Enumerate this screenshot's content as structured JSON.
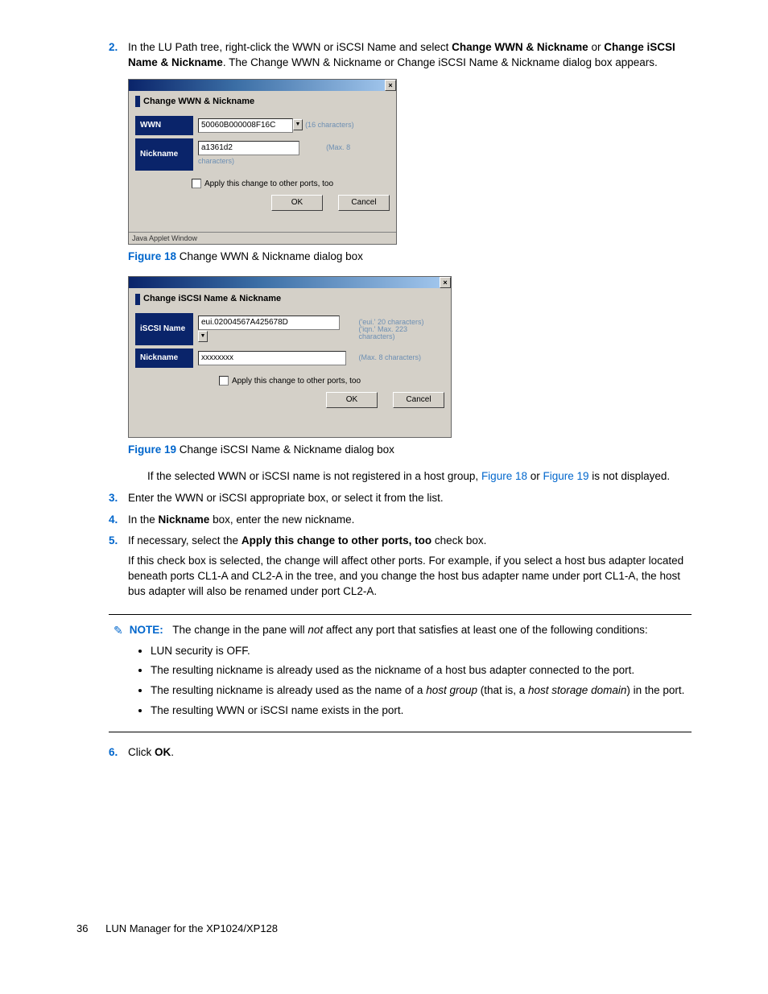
{
  "steps": {
    "s2_num": "2.",
    "s2_a": "In the LU Path tree, right-click the WWN or iSCSI Name and select ",
    "s2_b": "Change WWN & Nickname",
    "s2_c": " or ",
    "s2_d": "Change iSCSI Name & Nickname",
    "s2_e": ". The Change WWN & Nickname or Change iSCSI Name & Nickname dialog box appears.",
    "s2_body1_a": "If the selected WWN or iSCSI name is not registered in a host group, ",
    "s2_body1_b": "Figure 18",
    "s2_body1_c": " or ",
    "s2_body1_d": "Figure 19",
    "s2_body1_e": " is not displayed.",
    "s3_num": "3.",
    "s3": "Enter the WWN or iSCSI appropriate box, or select it from the list.",
    "s4_num": "4.",
    "s4_a": "In the ",
    "s4_b": "Nickname",
    "s4_c": " box, enter the new nickname.",
    "s5_num": "5.",
    "s5_a": "If necessary, select the ",
    "s5_b": "Apply this change to other ports, too",
    "s5_c": " check box.",
    "s5_body": "If this check box is selected, the change will affect other ports. For example, if you select a host bus adapter located beneath ports CL1-A and CL2-A in the tree, and you change the host bus adapter name under port CL1-A, the host bus adapter will also be renamed under port CL2-A.",
    "s6_num": "6.",
    "s6_a": "Click ",
    "s6_b": "OK",
    "s6_c": "."
  },
  "fig18": {
    "label": "Figure 18",
    "caption": " Change WWN & Nickname dialog box",
    "title": "Change WWN & Nickname",
    "row1_label": "WWN",
    "row1_value": "50060B000008F16C",
    "row1_hint": "(16 characters)",
    "row2_label": "Nickname",
    "row2_value": "a1361d2",
    "row2_hint": "(Max. 8 characters)",
    "apply": "Apply this change to other ports, too",
    "ok": "OK",
    "cancel": "Cancel",
    "status": "Java Applet Window"
  },
  "fig19": {
    "label": "Figure 19",
    "caption": " Change iSCSI Name & Nickname dialog box",
    "title": "Change iSCSI Name & Nickname",
    "row1_label": "iSCSI Name",
    "row1_value": "eui.02004567A425678D",
    "row1_hint1": "('eui.' 20 characters)",
    "row1_hint2": "('iqn.' Max. 223 characters)",
    "row2_label": "Nickname",
    "row2_value": "xxxxxxxx",
    "row2_hint": "(Max. 8 characters)",
    "apply": "Apply this change to other ports, too",
    "ok": "OK",
    "cancel": "Cancel"
  },
  "note": {
    "label": "NOTE:",
    "lead_a": "The change in the pane will ",
    "lead_b": "not",
    "lead_c": " affect any port that satisfies at least one of the following conditions:",
    "b1": "LUN security is OFF.",
    "b2": "The resulting nickname is already used as the nickname of a host bus adapter connected to the port.",
    "b3_a": "The resulting nickname is already used as the name of a ",
    "b3_b": "host group",
    "b3_c": " (that is, a ",
    "b3_d": "host storage domain",
    "b3_e": ") in the port.",
    "b4": "The resulting WWN or iSCSI name exists in the port."
  },
  "footer": {
    "page": "36",
    "title": "LUN Manager for the XP1024/XP128"
  }
}
